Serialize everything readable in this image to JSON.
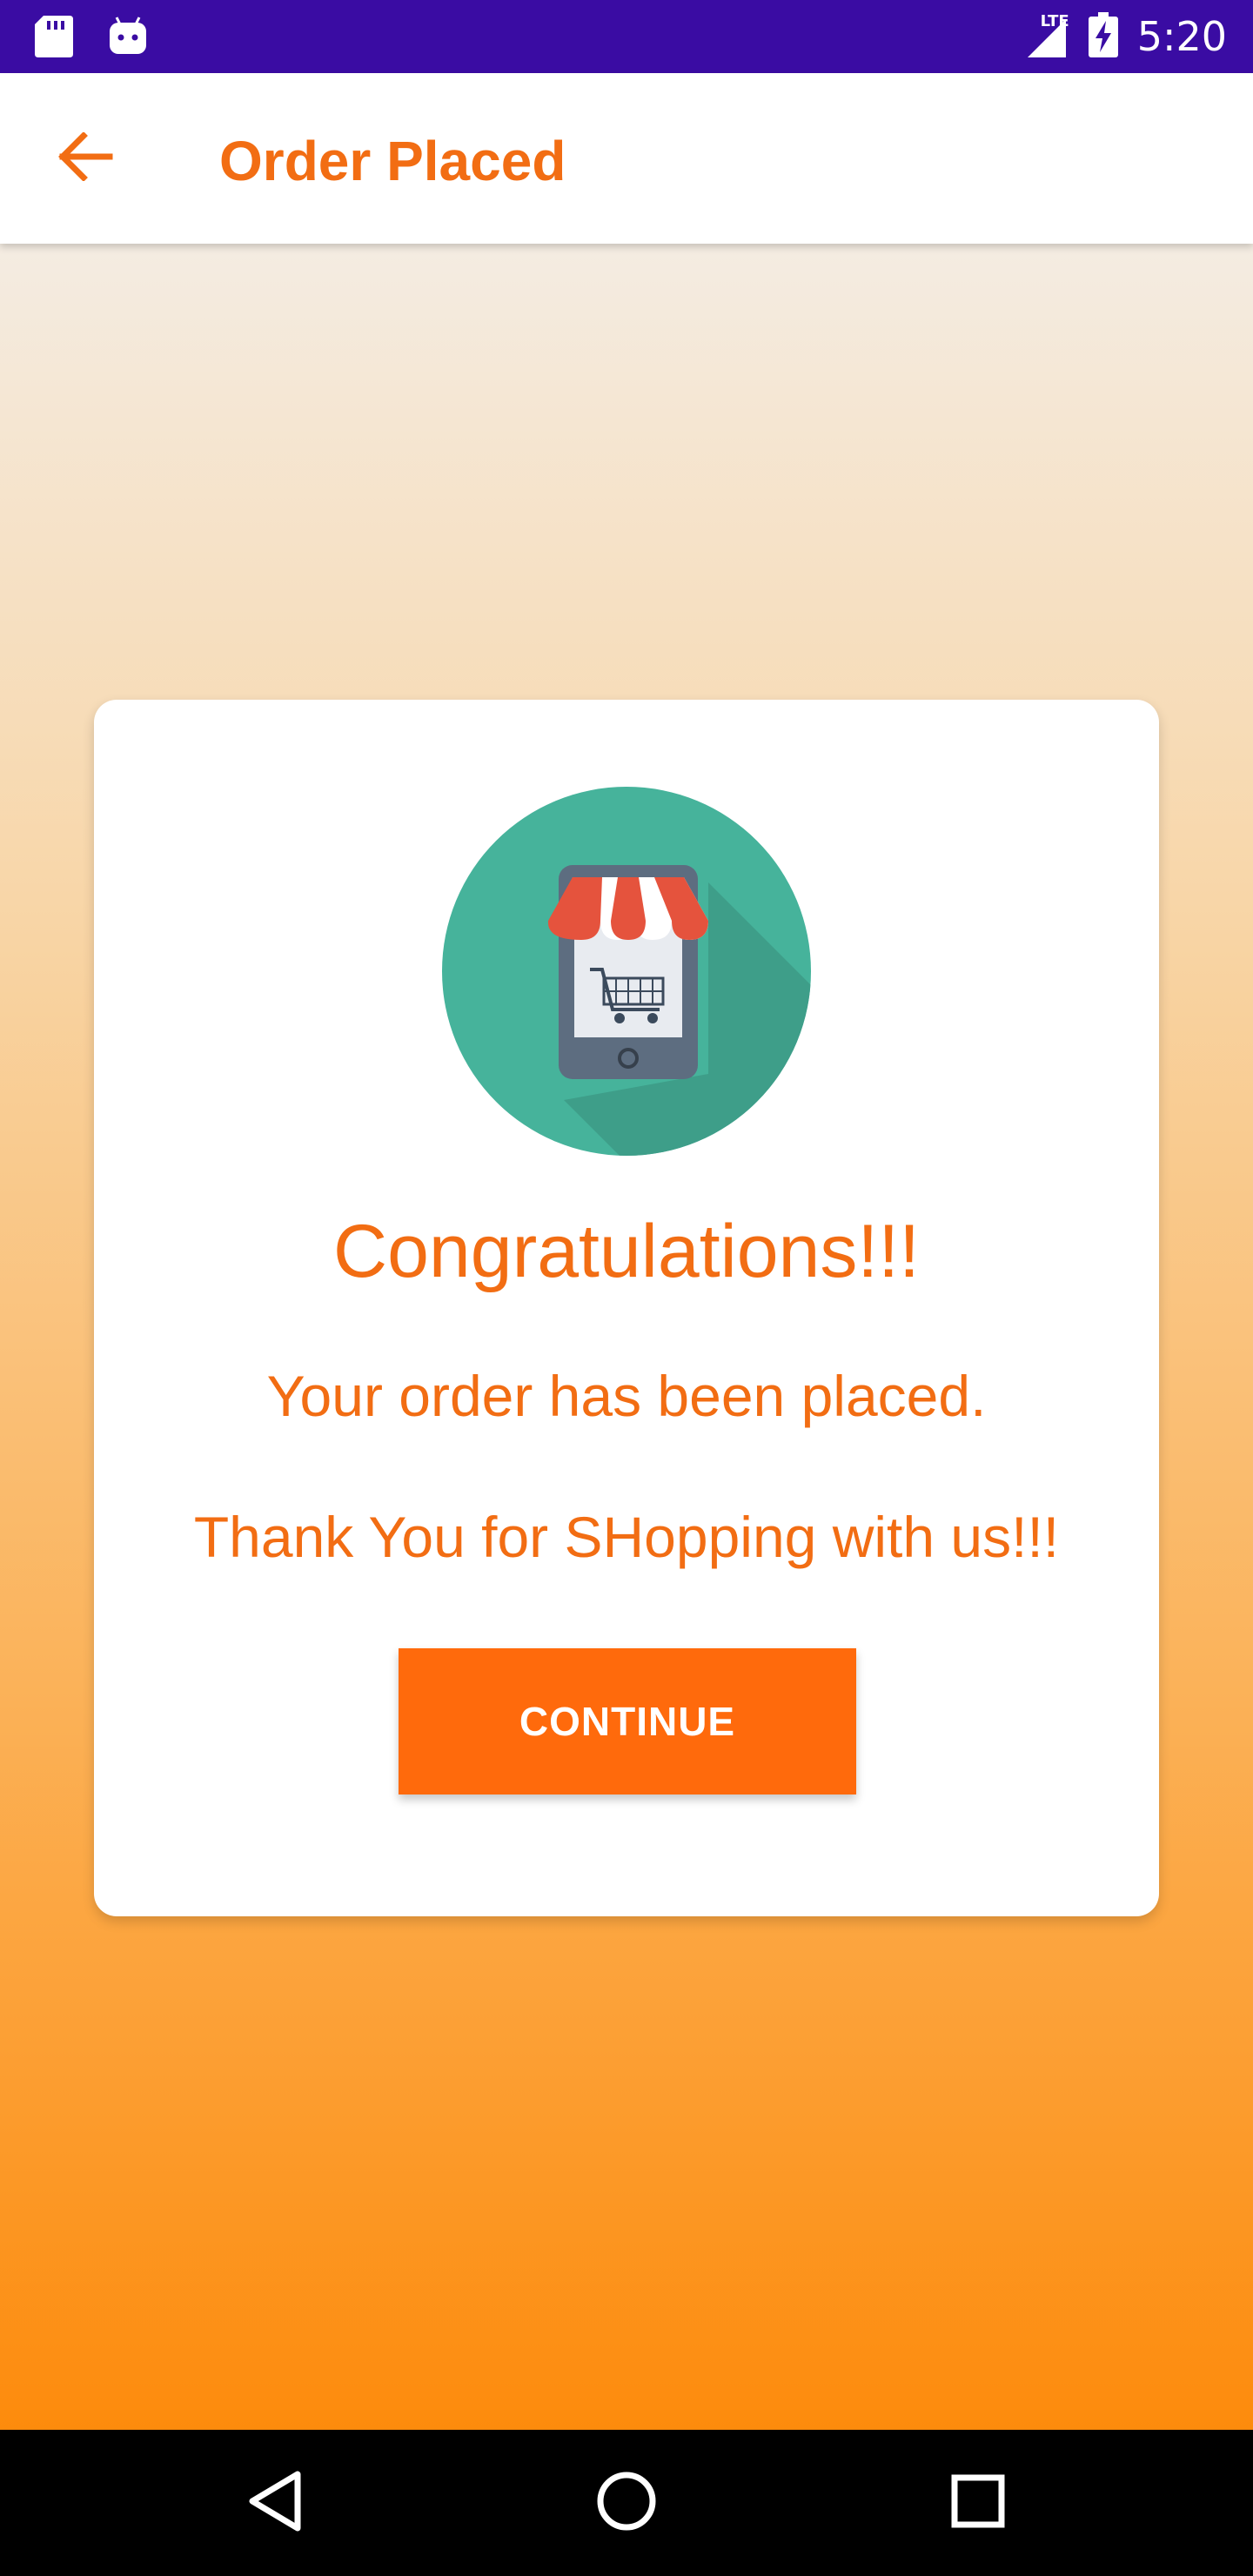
{
  "status_bar": {
    "time": "5:20",
    "network": "LTE",
    "icons": [
      "sd-card-icon",
      "android-icon",
      "signal-icon",
      "battery-charging-icon"
    ]
  },
  "app_bar": {
    "title": "Order Placed",
    "back_icon": "arrow-back-icon"
  },
  "card": {
    "illustration": "mobile-shop-cart-icon",
    "headline": "Congratulations!!!",
    "message": "Your order has been placed.",
    "thanks": "Thank You for SHopping with us!!!",
    "button_label": "CONTINUE"
  },
  "nav_bar": {
    "icons": [
      "back-triangle-icon",
      "home-circle-icon",
      "recents-square-icon"
    ]
  },
  "colors": {
    "status_bar": "#3a0ca3",
    "accent": "#f26d13",
    "button": "#ff6a0c",
    "gradient_top": "#f4ece2",
    "gradient_bottom": "#fd8b0c",
    "illustration_circle": "#46b39b"
  }
}
